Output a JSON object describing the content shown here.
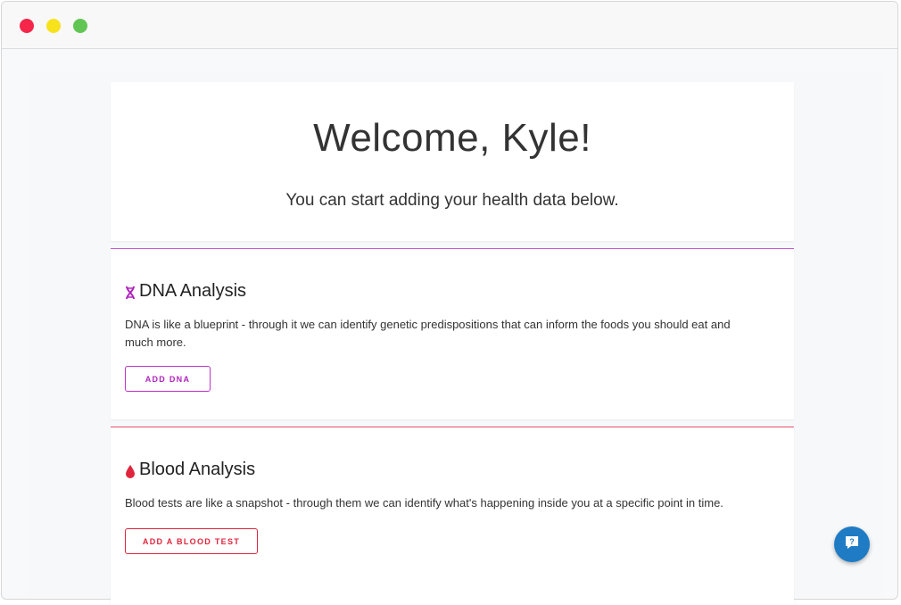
{
  "welcome": {
    "title": "Welcome, Kyle!",
    "subtitle": "You can start adding your health data below."
  },
  "sections": [
    {
      "title": "DNA Analysis",
      "icon": "dna-icon",
      "accent": "#b024bd",
      "description": "DNA is like a blueprint - through it we can identify genetic predispositions that can inform the foods you should eat and much more.",
      "button_label": "ADD DNA"
    },
    {
      "title": "Blood Analysis",
      "icon": "blood-drop-icon",
      "accent": "#e0243d",
      "description": "Blood tests are like a snapshot - through them we can identify what's happening inside you at a specific point in time.",
      "button_label": "ADD A BLOOD TEST"
    }
  ],
  "chat": {
    "icon": "help-chat-icon",
    "color": "#1f7bc4"
  }
}
